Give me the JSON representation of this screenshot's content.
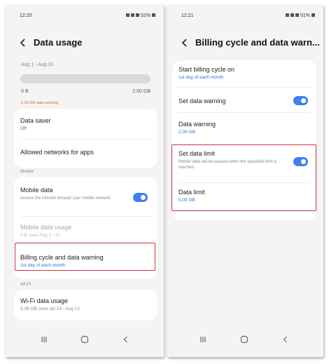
{
  "status_left": {
    "time": "12:20"
  },
  "status_right": {
    "time": "12:21"
  },
  "battery_left": "52%",
  "battery_right": "51%",
  "left": {
    "title": "Data usage",
    "date_range": "Aug 1 - Aug 31",
    "usage_fraction": 0,
    "bar_min": "0 B",
    "bar_max": "2.00 GB",
    "warning_label": "2.00 GB data warning",
    "data_saver": {
      "title": "Data saver",
      "value": "Off"
    },
    "allowed_networks": {
      "title": "Allowed networks for apps"
    },
    "mobile_section": "Mobile",
    "mobile_data": {
      "title": "Mobile data",
      "desc": "Access the internet through your mobile network.",
      "enabled": true
    },
    "mobile_usage": {
      "title": "Mobile data usage",
      "value": "0 B used Aug 1 - 31"
    },
    "billing": {
      "title": "Billing cycle and data warning",
      "value": "1st day of each month"
    },
    "wifi_section": "Wi-Fi",
    "wifi_usage": {
      "title": "Wi-Fi data usage",
      "value": "5.36 GB used Jul 15 - Aug 12"
    }
  },
  "right": {
    "title": "Billing cycle and data warn...",
    "start_cycle": {
      "title": "Start billing cycle on",
      "value": "1st day of each month"
    },
    "set_warning": {
      "title": "Set data warning",
      "enabled": true
    },
    "data_warning": {
      "title": "Data warning",
      "value": "2.00 GB"
    },
    "set_limit": {
      "title": "Set data limit",
      "desc": "Mobile data will be paused when the specified limit is reached.",
      "enabled": true
    },
    "data_limit": {
      "title": "Data limit",
      "value": "5.00 GB"
    }
  },
  "icons": [
    "back-arrow-icon",
    "recents-icon",
    "home-icon",
    "back-nav-icon"
  ],
  "colors": {
    "accent": "#3e7ff0",
    "link_blue": "#2d6cdf",
    "warning_orange": "#e2602a",
    "highlight_red": "#c8323c",
    "background": "#f4f4f5"
  }
}
